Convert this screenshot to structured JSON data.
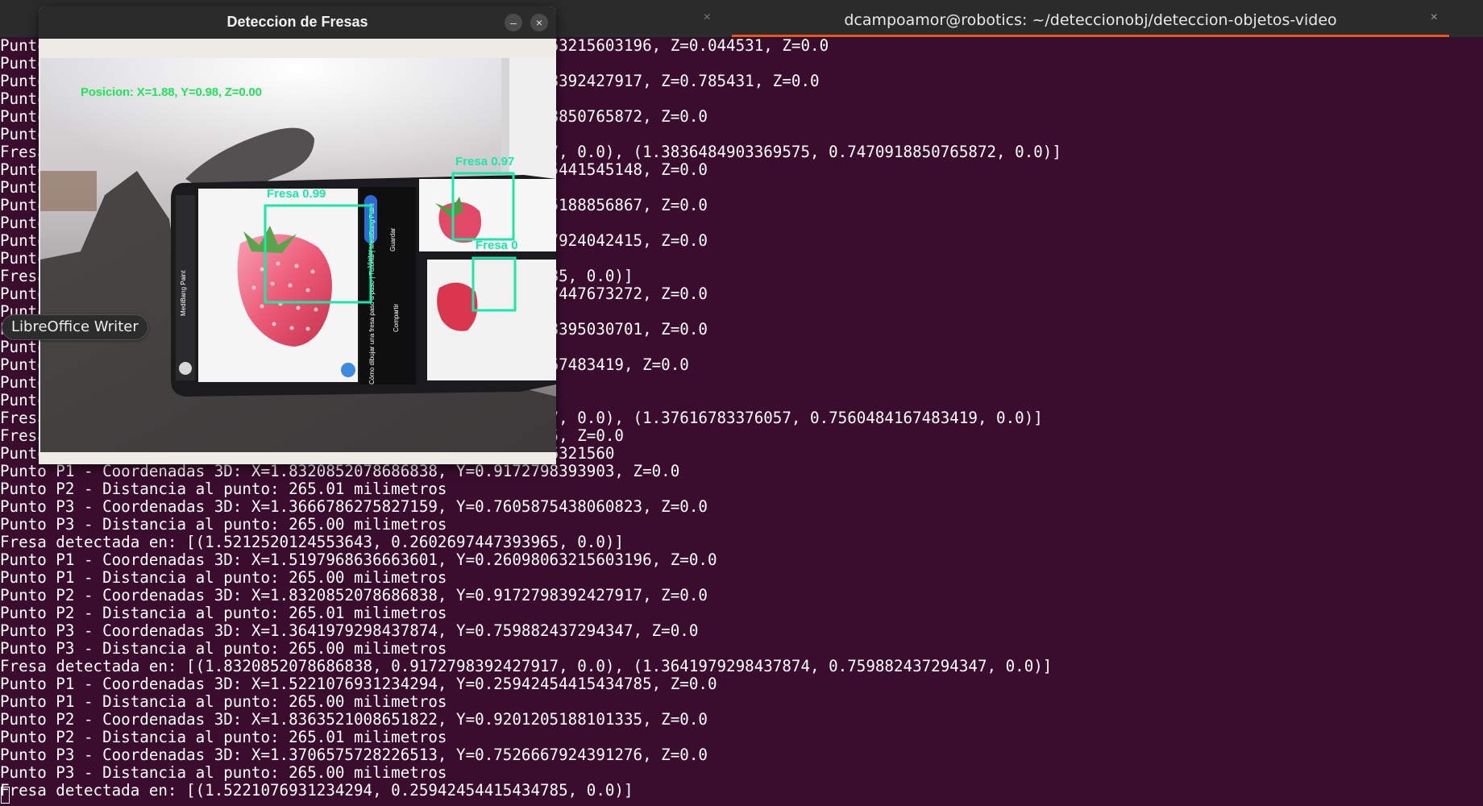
{
  "terminal": {
    "tab_title": "dcampoamor@robotics: ~/deteccionobj/deteccion-objetos-video",
    "close_glyph": "×",
    "lines": [
      "Punto P1 - Coordenadas 3D: X=1.5197968636663601, Y=0.26098063215603196, Z=0.044531, Z=0.0",
      "Punto P1 - Distancia al punto: 265.00 milimetros",
      "Punto P2 - Coordenadas 3D: X=1.8320852078686838, Y=0.9172798392427917, Z=0.785431, Z=0.0",
      "Punto P2 - Distancia al punto: 265.01 milimetros",
      "Punto P3 - Coordenadas 3D: X=1.3836484903369575, Y=0.7470918850765872, Z=0.0",
      "Punto P3 - Distancia al punto: 265.00 milimetros",
      "Fresa detectada en: [(1.8320852078686838, 0.9172798392427917, 0.0), (1.3836484903369575, 0.7470918850765872, 0.0)]",
      "Punto P1 - Coordenadas 3D: X=1.5221076931234294, Y=0.2594245441545148, Z=0.0",
      "Punto P1 - Distancia al punto: 265.00 milimetros",
      "Punto P2 - Coordenadas 3D: X=1.8363521008651822, Y=0.9201205188856867, Z=0.0",
      "Punto P2 - Distancia al punto: 265.01 milimetros",
      "Punto P3 - Coordenadas 3D: X=1.3706575728226513, Y=0.7526667924042415, Z=0.0",
      "Punto P3 - Distancia al punto: 265.00 milimetros",
      "Fresa detectada en: [(1.5221076931234294, 0.25942454415434785, 0.0)]",
      "Punto P1 - Coordenadas 3D: X=1.5212520124553643, Y=0.2602697447673272, Z=0.0",
      "Punto P1 - Distancia al punto: 265.00 milimetros",
      "Punto P2 - Coordenadas 3D: X=1.8320852078686838, Y=0.9172798395030701, Z=0.0",
      "Punto P2 - Distancia al punto: 265.01 milimetros",
      "Punto P3 - Coordenadas 3D: X=1.37616783376057, Y=0.7560484167483419, Z=0.0",
      "Punto P3 - Distancia al punto: 265.00 milimetros",
      "Punto P3 - Distancia al punto: 265.00 milimetros",
      "Fresa detectada en: [(1.8320852078686838, 0.9172798392427917, 0.0), (1.37616783376057, 0.7560484167483419, 0.0)]",
      "Fresa detectada en: [(1.5212520124553643, 0.2602697447393965, Z=0.0",
      "Punto P1 - Coordenadas 3D: X=1.5197968636663601, Y=0.2609806321560",
      "Punto P1 - Coordenadas 3D: X=1.8320852078686838, Y=0.9172798393903, Z=0.0",
      "Punto P2 - Distancia al punto: 265.01 milimetros",
      "Punto P3 - Coordenadas 3D: X=1.3666786275827159, Y=0.7605875438060823, Z=0.0",
      "Punto P3 - Distancia al punto: 265.00 milimetros",
      "Fresa detectada en: [(1.5212520124553643, 0.2602697447393965, 0.0)]",
      "Punto P1 - Coordenadas 3D: X=1.5197968636663601, Y=0.26098063215603196, Z=0.0",
      "Punto P1 - Distancia al punto: 265.00 milimetros",
      "Punto P2 - Coordenadas 3D: X=1.8320852078686838, Y=0.9172798392427917, Z=0.0",
      "Punto P2 - Distancia al punto: 265.01 milimetros",
      "Punto P3 - Coordenadas 3D: X=1.3641979298437874, Y=0.759882437294347, Z=0.0",
      "Punto P3 - Distancia al punto: 265.00 milimetros",
      "Fresa detectada en: [(1.8320852078686838, 0.9172798392427917, 0.0), (1.3641979298437874, 0.759882437294347, 0.0)]",
      "Punto P1 - Coordenadas 3D: X=1.5221076931234294, Y=0.25942454415434785, Z=0.0",
      "Punto P1 - Distancia al punto: 265.00 milimetros",
      "Punto P2 - Coordenadas 3D: X=1.8363521008651822, Y=0.9201205188101335, Z=0.0",
      "Punto P2 - Distancia al punto: 265.01 milimetros",
      "Punto P3 - Coordenadas 3D: X=1.3706575728226513, Y=0.7526667924391276, Z=0.0",
      "Punto P3 - Distancia al punto: 265.00 milimetros",
      "Fresa detectada en: [(1.5221076931234294, 0.25942454415434785, 0.0)]"
    ]
  },
  "tooltip": {
    "label": "LibreOffice Writer"
  },
  "cam_window": {
    "title": "Deteccion de Fresas",
    "minimize_glyph": "–",
    "close_glyph": "×",
    "position_text": "Posicion: X=1.88, Y=0.98, Z=0.00",
    "detections": [
      {
        "label": "Fresa 0.99"
      },
      {
        "label": "Fresa 0.97"
      },
      {
        "label": "Fresa 0"
      }
    ],
    "phone_texts": {
      "caption": "Cómo dibujar una fresa paso a paso | Tutorial | MediBang Paint",
      "share": "Compartir",
      "save": "Guardar",
      "visit": "Visitar",
      "app_name": "MediBang Paint"
    },
    "colors": {
      "detection_box": "#19e8a9",
      "position_text": "#22e35a"
    }
  }
}
